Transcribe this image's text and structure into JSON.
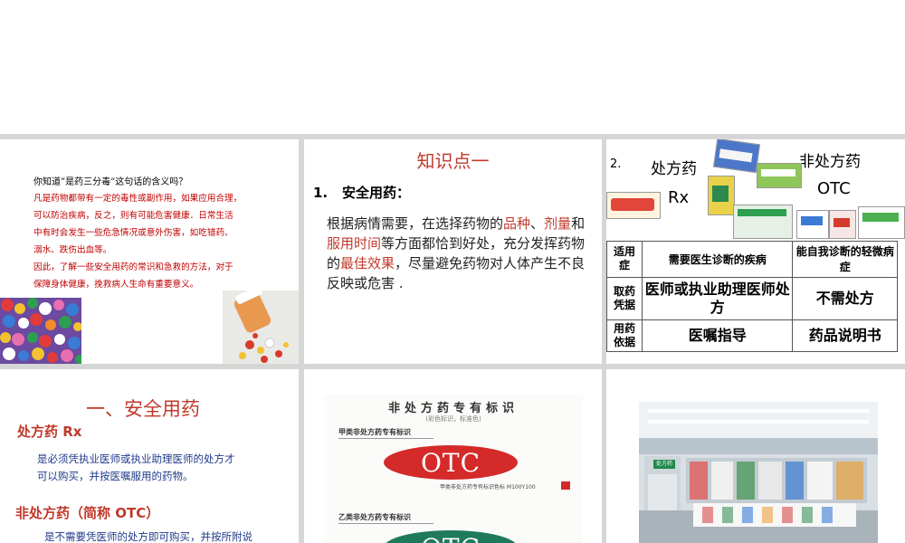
{
  "slide1": {
    "question": "你知道”是药三分毒”这句话的含义吗？",
    "lines": [
      "凡是药物都带有一定的毒性或副作用，如果应用合理，",
      "可以防治疾病，反之，则有可能危害健康．日常生活",
      "中有时会发生一些危急情况或意外伤害，如吃错药、",
      "溺水、跌伤出血等。",
      "因此，了解一些安全用药的常识和急救的方法，对于",
      "保障身体健康，挽救病人生命有重要意义。"
    ]
  },
  "slide2": {
    "title": "知识点一",
    "heading_num": "1.",
    "heading": "安全用药：",
    "p_a": "根据病情需要，在选择药物的",
    "p_h1": "品种",
    "p_b": "、",
    "p_h2": "剂量",
    "p_c": "和",
    "p_h3": "服用时间",
    "p_d": "等方面都恰到好处，充分发挥药物的",
    "p_h4": "最佳效果",
    "p_e": "，尽量避免药物对人体产生不良反映或危害 ."
  },
  "slide3": {
    "num": "2.",
    "rx_label": "处方药",
    "rx_code": "Rx",
    "otc_label": "非处方药",
    "otc_code": "OTC",
    "table": {
      "r1_h": "适用症",
      "r1_a": "需要医生诊断的疾病",
      "r1_b": "能自我诊断的轻微病症",
      "r2_h": "取药凭据",
      "r2_a": "医师或执业助理医师处方",
      "r2_b": "不需处方",
      "r3_h": "用药依据",
      "r3_a": "医嘱指导",
      "r3_b": "药品说明书"
    }
  },
  "slide4": {
    "title": "一、安全用药",
    "rx_title": "处方药 Rx",
    "rx_desc_1": "是必须凭执业医师或执业助理医师的处方才",
    "rx_desc_2": "可以购买，并按医嘱服用的药物。",
    "otc_title": "非处方药（简称 OTC）",
    "otc_desc": "是不需要凭医师的处方即可购买，并按所附说"
  },
  "slide5": {
    "title": "非处方药专有标识",
    "subtitle": "(彩色标识，标准色)",
    "class_a": "甲类非处方药专有标识",
    "otc_text": "OTC",
    "caption": "甲类非处方药专有标识色标 M100Y100",
    "class_b": "乙类非处方药专有标识",
    "colors": {
      "red": "#d42a2a",
      "green": "#1e7a5a"
    }
  },
  "slide6": {
    "sign": "处方药"
  }
}
